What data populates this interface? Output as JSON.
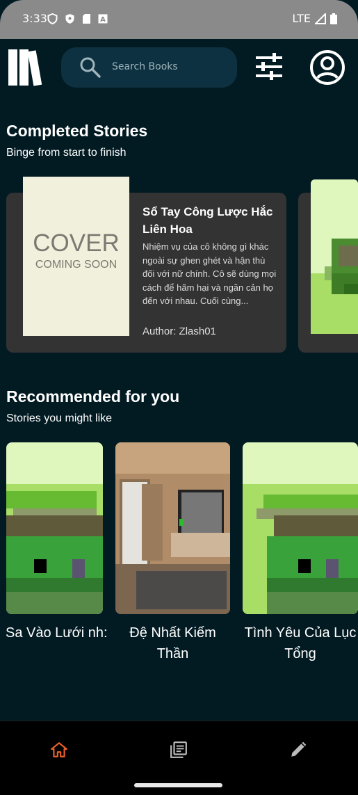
{
  "status": {
    "time": "3:33",
    "network": "LTE"
  },
  "search": {
    "placeholder": "Search Books"
  },
  "completed": {
    "title": "Completed Stories",
    "subtitle": "Binge from start to finish",
    "book": {
      "cover_line1": "COVER",
      "cover_line2": "COMING SOON",
      "title": "Sổ Tay Công Lược Hắc Liên Hoa",
      "description": "Nhiệm vụ của cô không gì khác ngoài sự ghen ghét và hận thù đối với nữ chính. Cô sẽ dùng mọi cách để hãm hại và ngăn cản họ đến với nhau. Cuối cùng...",
      "author": "Author: Zlash01"
    }
  },
  "recommended": {
    "title": "Recommended for you",
    "subtitle": "Stories you might like",
    "items": [
      {
        "title": "Sa Vào Lưới nh: Vợ Yêu K..."
      },
      {
        "title": "Đệ Nhất Kiếm Thần"
      },
      {
        "title": "Tình Yêu Của Lục Tổng"
      }
    ]
  },
  "nav": {
    "items": [
      "home-icon",
      "library-icon",
      "edit-icon"
    ],
    "active": "home-icon"
  },
  "colors": {
    "background": "#021a22",
    "accent": "#e8602c",
    "card": "#333333",
    "search": "#0d3140"
  }
}
